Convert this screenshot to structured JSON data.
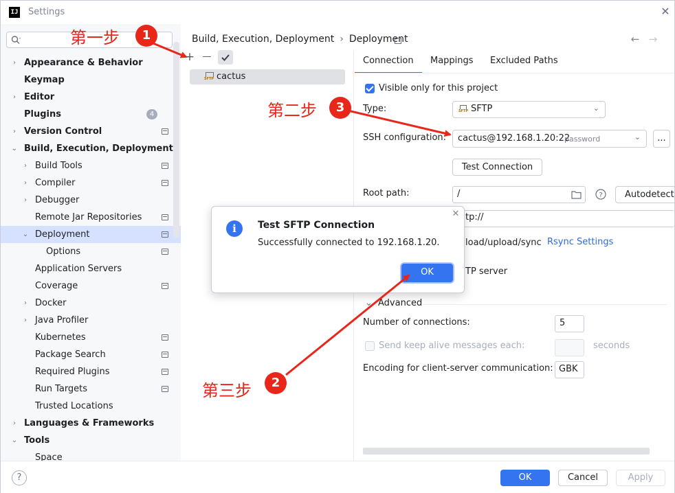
{
  "window": {
    "title": "Settings",
    "close": "✕",
    "app_icon": "IJ"
  },
  "sidebar": {
    "search_placeholder": "",
    "items": [
      {
        "label": "Appearance & Behavior",
        "bold": true,
        "level": 0,
        "arrow": "›",
        "pin": false
      },
      {
        "label": "Keymap",
        "bold": true,
        "level": 0,
        "arrow": "",
        "pin": false
      },
      {
        "label": "Editor",
        "bold": true,
        "level": 0,
        "arrow": "›",
        "pin": false
      },
      {
        "label": "Plugins",
        "bold": true,
        "level": 0,
        "arrow": "",
        "pin": false,
        "badge": "4"
      },
      {
        "label": "Version Control",
        "bold": true,
        "level": 0,
        "arrow": "›",
        "pin": true
      },
      {
        "label": "Build, Execution, Deployment",
        "bold": true,
        "level": 0,
        "arrow": "⌄",
        "pin": false
      },
      {
        "label": "Build Tools",
        "bold": false,
        "level": 1,
        "arrow": "›",
        "pin": true
      },
      {
        "label": "Compiler",
        "bold": false,
        "level": 1,
        "arrow": "›",
        "pin": true
      },
      {
        "label": "Debugger",
        "bold": false,
        "level": 1,
        "arrow": "›",
        "pin": false
      },
      {
        "label": "Remote Jar Repositories",
        "bold": false,
        "level": 1,
        "arrow": "",
        "pin": true
      },
      {
        "label": "Deployment",
        "bold": false,
        "level": 1,
        "arrow": "⌄",
        "pin": true,
        "selected": true
      },
      {
        "label": "Options",
        "bold": false,
        "level": 2,
        "arrow": "",
        "pin": true
      },
      {
        "label": "Application Servers",
        "bold": false,
        "level": 1,
        "arrow": "",
        "pin": false
      },
      {
        "label": "Coverage",
        "bold": false,
        "level": 1,
        "arrow": "",
        "pin": true
      },
      {
        "label": "Docker",
        "bold": false,
        "level": 1,
        "arrow": "›",
        "pin": false
      },
      {
        "label": "Java Profiler",
        "bold": false,
        "level": 1,
        "arrow": "›",
        "pin": false
      },
      {
        "label": "Kubernetes",
        "bold": false,
        "level": 1,
        "arrow": "",
        "pin": true
      },
      {
        "label": "Package Search",
        "bold": false,
        "level": 1,
        "arrow": "",
        "pin": true
      },
      {
        "label": "Required Plugins",
        "bold": false,
        "level": 1,
        "arrow": "",
        "pin": true
      },
      {
        "label": "Run Targets",
        "bold": false,
        "level": 1,
        "arrow": "",
        "pin": true
      },
      {
        "label": "Trusted Locations",
        "bold": false,
        "level": 1,
        "arrow": "",
        "pin": false
      },
      {
        "label": "Languages & Frameworks",
        "bold": true,
        "level": 0,
        "arrow": "›",
        "pin": false
      },
      {
        "label": "Tools",
        "bold": true,
        "level": 0,
        "arrow": "⌄",
        "pin": false
      },
      {
        "label": "Space",
        "bold": false,
        "level": 1,
        "arrow": "",
        "pin": false
      }
    ]
  },
  "breadcrumb": {
    "parent": "Build, Execution, Deployment",
    "sep": "›",
    "current": "Deployment"
  },
  "nav": {
    "back": "←",
    "forward": "→"
  },
  "server_list": {
    "add": "+",
    "remove": "—",
    "items": [
      {
        "label": "cactus",
        "icon_text": "SFTP"
      }
    ]
  },
  "tabs": [
    {
      "label": "Connection",
      "active": true
    },
    {
      "label": "Mappings"
    },
    {
      "label": "Excluded Paths"
    }
  ],
  "form": {
    "visible_only_label": "Visible only for this project",
    "type_label": "Type:",
    "type_value": "SFTP",
    "ssh_label": "SSH configuration:",
    "ssh_value": "cactus@192.168.1.20:22",
    "ssh_hint": "password",
    "ssh_more": "...",
    "test_connection": "Test Connection",
    "root_path_label": "Root path:",
    "root_path_value": "/",
    "autodetect": "Autodetect",
    "web_url_value": "tp://",
    "mapping_partial": "load/upload/sync",
    "rsync_link": "Rsync Settings",
    "sftp_partial": "TP server",
    "advanced_label": "Advanced",
    "connections_label": "Number of connections:",
    "connections_value": "5",
    "keep_alive_label": "Send keep alive messages each:",
    "keep_alive_unit": "seconds",
    "encoding_label": "Encoding for client-server communication:",
    "encoding_value": "GBK"
  },
  "dialog": {
    "title": "Test SFTP Connection",
    "message": "Successfully connected to 192.168.1.20.",
    "ok": "OK",
    "close": "✕",
    "icon": "i"
  },
  "footer": {
    "help": "?",
    "ok": "OK",
    "cancel": "Cancel",
    "apply": "Apply"
  },
  "annotations": {
    "step1": "第一步",
    "step2": "第二步",
    "step3": "第三步",
    "badge1": "1",
    "badge2": "3",
    "badge3": "2",
    "color": "#e8261a"
  }
}
